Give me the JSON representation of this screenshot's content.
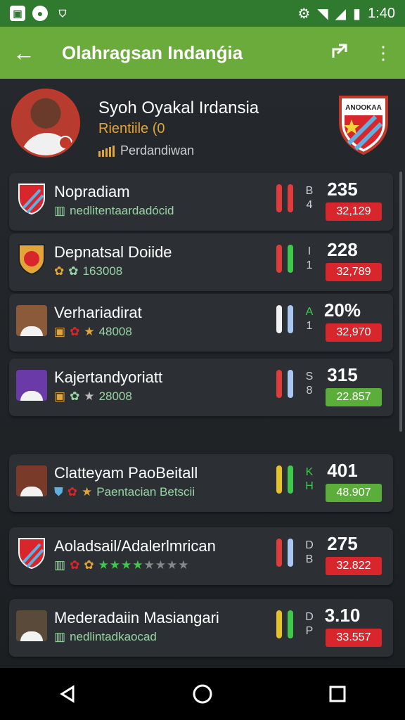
{
  "status_bar": {
    "time": "1:40",
    "icons": [
      "notification-icon",
      "camera-icon",
      "shield-icon",
      "settings-icon",
      "wifi-icon",
      "signal-icon",
      "battery-icon"
    ]
  },
  "app_bar": {
    "title": "Olahragsan Indanǵia",
    "back_icon": "arrow-left-icon",
    "share_icon": "share-icon",
    "menu_icon": "more-vertical-icon"
  },
  "profile": {
    "name": "Syoh Oyakal Irdansia",
    "subtitle": "Rientiile (0",
    "meta": "Perdandiwan",
    "crest_text": "ANOOKAA"
  },
  "rows": [
    {
      "label": "Nopradiam",
      "detail": "nedlitentaardadócid",
      "code1": "B",
      "code2": "4",
      "score": "235",
      "chip": "32,129",
      "chip_color": "red",
      "pill1": "#e23b3b",
      "pill2": "#e23b3b"
    },
    {
      "label": "Depnatsal Doiide",
      "detail": "163008",
      "code1": "I",
      "code2": "1",
      "score": "228",
      "chip": "32,789",
      "chip_color": "red",
      "pill1": "#e23b3b",
      "pill2": "#3ec94a"
    },
    {
      "label": "Verhariadirat",
      "detail": "48008",
      "code1": "A",
      "code2": "1",
      "score": "20%",
      "chip": "32,970",
      "chip_color": "red",
      "pill1": "#f2f2f2",
      "pill2": "#a9c7f2"
    },
    {
      "label": "Kajertandyoriatt",
      "detail": "28008",
      "code1": "S",
      "code2": "8",
      "score": "315",
      "chip": "22.857",
      "chip_color": "green",
      "pill1": "#e23b3b",
      "pill2": "#a9c7f2"
    },
    {
      "label": "Clatteyam PaoBeitall",
      "detail": "Paentacian Betscii",
      "code1": "K",
      "code2": "H",
      "score": "401",
      "chip": "48.907",
      "chip_color": "green",
      "pill1": "#e6c229",
      "pill2": "#3ec94a"
    },
    {
      "label": "Aoladsail/Adalerlmrican",
      "detail": "",
      "code1": "D",
      "code2": "B",
      "score": "275",
      "chip": "32.822",
      "chip_color": "red",
      "pill1": "#e23b3b",
      "pill2": "#a9c7f2"
    },
    {
      "label": "Mederadaiin Masiangari",
      "detail": "nedlintadkaocad",
      "code1": "D",
      "code2": "P",
      "score": "3.10",
      "chip": "33.557",
      "chip_color": "red",
      "pill1": "#e6c229",
      "pill2": "#3ec94a"
    }
  ],
  "nav_bar": {
    "back": "back-triangle-icon",
    "home": "home-circle-icon",
    "recents": "recents-square-icon"
  }
}
